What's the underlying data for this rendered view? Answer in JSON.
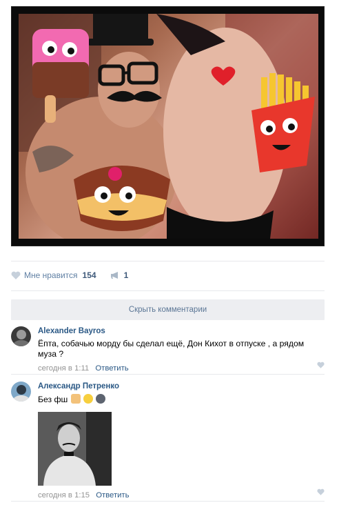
{
  "post": {
    "photo_alt": "",
    "like_label": "Мне нравится",
    "like_count": "154",
    "share_count": "1"
  },
  "comments_toggle": {
    "label": "Скрыть комментарии"
  },
  "comments": [
    {
      "author": "Alexander Bayros",
      "text": "Ёпта, собачью морду бы сделал ещё, Дон Кихот в отпуске , а рядом муза ?",
      "time": "сегодня в 1:11",
      "reply_label": "Ответить"
    },
    {
      "author": "Александр Петренко",
      "text": "Без фш",
      "time": "сегодня в 1:15",
      "reply_label": "Ответить"
    }
  ],
  "colors": {
    "link": "#2a5885",
    "muted": "#939393",
    "accent_blue": "#5f7fa3",
    "toggle_bg": "#edeef1"
  }
}
